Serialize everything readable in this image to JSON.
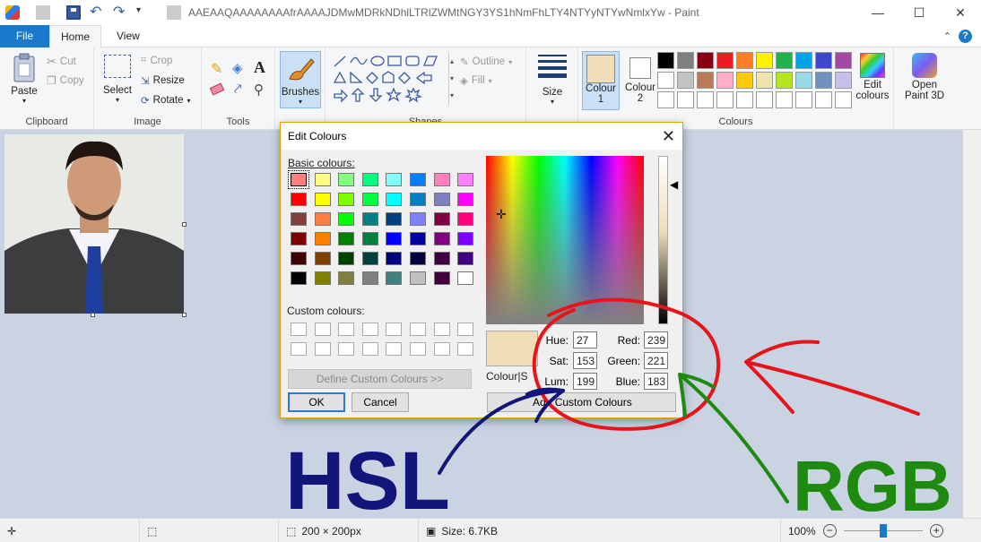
{
  "window": {
    "title": "AAEAAQAAAAAAAAfrAAAAJDMwMDRkNDhlLTRlZWMtNGY3YS1hNmFhLTY4NTYyNTYwNmlxYw - Paint",
    "minimize": "—",
    "maximize": "☐",
    "close": "✕"
  },
  "tabs": {
    "file": "File",
    "home": "Home",
    "view": "View"
  },
  "ribbon": {
    "clipboard": {
      "paste": "Paste",
      "cut": "Cut",
      "copy": "Copy",
      "label": "Clipboard"
    },
    "image": {
      "select": "Select",
      "crop": "Crop",
      "resize": "Resize",
      "rotate": "Rotate",
      "label": "Image"
    },
    "tools": {
      "label": "Tools"
    },
    "brushes": {
      "label": "Brushes"
    },
    "shapes": {
      "outline": "Outline",
      "fill": "Fill",
      "label": "Shapes"
    },
    "size": {
      "label": "Size"
    },
    "colours": {
      "colour1": "Colour",
      "colour1_num": "1",
      "colour2": "Colour",
      "colour2_num": "2",
      "edit": "Edit",
      "edit2": "colours",
      "label": "Colours",
      "colour1_value": "#efddb7",
      "colour2_value": "#ffffff",
      "palette_row1": [
        "#000000",
        "#7f7f7f",
        "#880015",
        "#ed1c24",
        "#ff7f27",
        "#fff200",
        "#22b14c",
        "#00a2e8",
        "#3f48cc",
        "#a349a4"
      ],
      "palette_row2": [
        "#ffffff",
        "#c3c3c3",
        "#b97a57",
        "#ffaec9",
        "#ffc90e",
        "#efe4b0",
        "#b5e61d",
        "#99d9ea",
        "#7092be",
        "#c8bfe7"
      ],
      "palette_row3": [
        "#ffffff",
        "#ffffff",
        "#ffffff",
        "#ffffff",
        "#ffffff",
        "#ffffff",
        "#ffffff",
        "#ffffff",
        "#ffffff",
        "#ffffff"
      ]
    },
    "paint3d": {
      "l1": "Open",
      "l2": "Paint 3D"
    }
  },
  "status": {
    "dimensions": "200 × 200px",
    "size": "Size: 6.7KB",
    "zoom": "100%",
    "zoom_level": 1.0
  },
  "dialog": {
    "title": "Edit Colours",
    "basic_label": "Basic colours:",
    "custom_label": "Custom colours:",
    "define_button": "Define Custom Colours >>",
    "ok": "OK",
    "cancel": "Cancel",
    "colour_solid": "Colour|Solid",
    "add_button": "Add to Custom Colours",
    "add_visible": "Ad",
    "add_tail": "Custom Colours",
    "hue_label": "Hue:",
    "sat_label": "Sat:",
    "lum_label": "Lum:",
    "red_label": "Red:",
    "green_label": "Green:",
    "blue_label": "Blue:",
    "hue": "27",
    "sat": "153",
    "lum": "199",
    "red": "239",
    "green": "221",
    "blue": "183",
    "preview_color": "#efddb7",
    "basic_colours": [
      "#ff8080",
      "#ffff80",
      "#80ff80",
      "#00ff80",
      "#80ffff",
      "#0080ff",
      "#ff80c0",
      "#ff80ff",
      "#ff0000",
      "#ffff00",
      "#80ff00",
      "#00ff40",
      "#00ffff",
      "#0080c0",
      "#8080c0",
      "#ff00ff",
      "#804040",
      "#ff8040",
      "#00ff00",
      "#008080",
      "#004080",
      "#8080ff",
      "#800040",
      "#ff0080",
      "#800000",
      "#ff8000",
      "#008000",
      "#008040",
      "#0000ff",
      "#0000a0",
      "#800080",
      "#8000ff",
      "#400000",
      "#804000",
      "#004000",
      "#004040",
      "#000080",
      "#000040",
      "#400040",
      "#400080",
      "#000000",
      "#808000",
      "#808040",
      "#808080",
      "#408080",
      "#c0c0c0",
      "#400040",
      "#ffffff"
    ]
  },
  "annotations": {
    "hsl": "HSL",
    "rgb": "RGB",
    "red_colour": "#e8141b",
    "blue_colour": "#12157a",
    "green_colour": "#1f8a10"
  }
}
